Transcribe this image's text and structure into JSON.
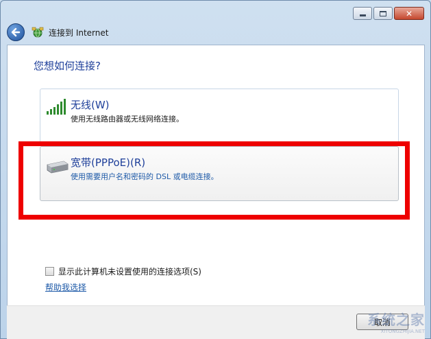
{
  "window": {
    "title": "连接到 Internet",
    "accent": "#1e3f9a",
    "highlight_color": "#ee0000"
  },
  "caption_buttons": [
    "minimize-icon",
    "maximize-icon",
    "close-icon"
  ],
  "nav": {
    "back_icon": "back-arrow-icon",
    "wizard_icon": "network-globe-icon"
  },
  "main": {
    "heading": "您想如何连接?",
    "options": [
      {
        "title": "无线(W)",
        "desc": "使用无线路由器或无线网络连接。",
        "icon": "signal-bars-icon"
      },
      {
        "title": "宽带(PPPoE)(R)",
        "desc": "使用需要用户名和密码的 DSL 或电缆连接。",
        "icon": "modem-icon"
      }
    ],
    "checkbox_label": "显示此计算机未设置使用的连接选项(S)",
    "help_link": "帮助我选择"
  },
  "footer": {
    "cancel_label": "取消"
  },
  "watermark": {
    "text": "系统之家",
    "sub": "XITONGZHIJIA.NET"
  }
}
